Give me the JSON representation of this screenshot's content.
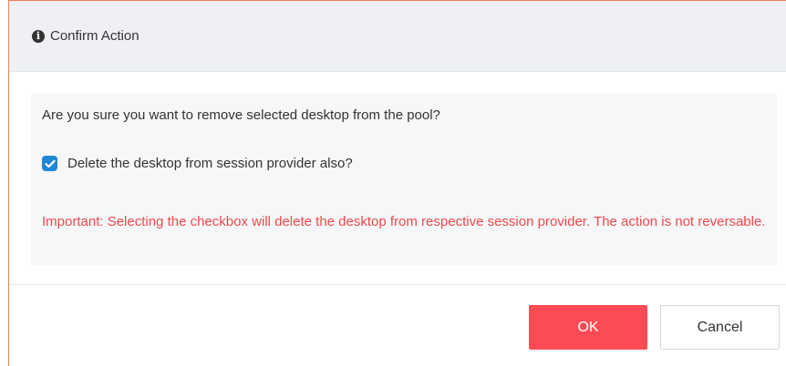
{
  "dialog": {
    "title": "Confirm Action",
    "title_icon": "info-circle-icon",
    "question": "Are you sure you want to remove selected desktop from the pool?",
    "checkbox": {
      "label": "Delete the desktop from session provider also?",
      "checked": true,
      "color": "#1e88d6"
    },
    "warning": "Important: Selecting the checkbox will delete the desktop from respective session provider. The action is not reversable.",
    "warning_color": "#f0484e",
    "buttons": {
      "ok_label": "OK",
      "cancel_label": "Cancel",
      "ok_color": "#fb4b55"
    }
  }
}
